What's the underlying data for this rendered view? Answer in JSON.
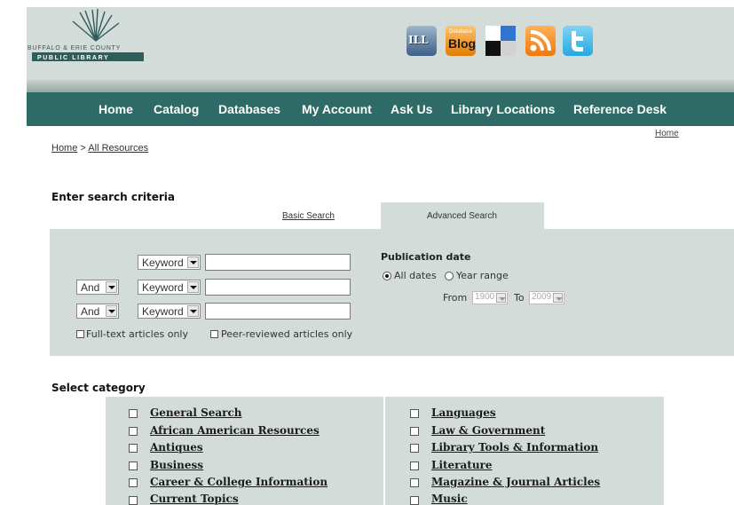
{
  "logo": {
    "line1": "BUFFALO & ERIE COUNTY",
    "line2": "PUBLIC LIBRARY"
  },
  "icons": [
    {
      "name": "ill-icon",
      "label": "ILL"
    },
    {
      "name": "database-blog-icon",
      "small": "Database",
      "label": "Blog"
    },
    {
      "name": "delicious-icon"
    },
    {
      "name": "rss-icon"
    },
    {
      "name": "twitter-icon"
    }
  ],
  "nav": [
    "Home",
    "Catalog",
    "Databases",
    "My Account",
    "Ask Us",
    "Library Locations",
    "Reference Desk"
  ],
  "home_top": "Home",
  "breadcrumb": {
    "home": "Home",
    "sep": ">",
    "current": "All Resources"
  },
  "search": {
    "heading": "Enter search criteria",
    "tab_basic": "Basic Search",
    "tab_advanced": "Advanced Search",
    "rows": [
      {
        "op": "",
        "field": "Keyword",
        "value": ""
      },
      {
        "op": "And",
        "field": "Keyword",
        "value": ""
      },
      {
        "op": "And",
        "field": "Keyword",
        "value": ""
      }
    ],
    "fulltext_label": "Full-text articles only",
    "peer_label": "Peer-reviewed articles only",
    "pub_heading": "Publication date",
    "all_dates": "All dates",
    "year_range": "Year range",
    "from_label": "From",
    "from_value": "1900",
    "to_label": "To",
    "to_value": "2009"
  },
  "category": {
    "heading": "Select category",
    "left": [
      "General Search",
      "African American Resources",
      "Antiques",
      "Business",
      "Career & College Information",
      "Current Topics"
    ],
    "right": [
      "Languages",
      "Law & Government",
      "Library Tools & Information",
      "Literature",
      "Magazine & Journal Articles",
      "Music"
    ]
  }
}
